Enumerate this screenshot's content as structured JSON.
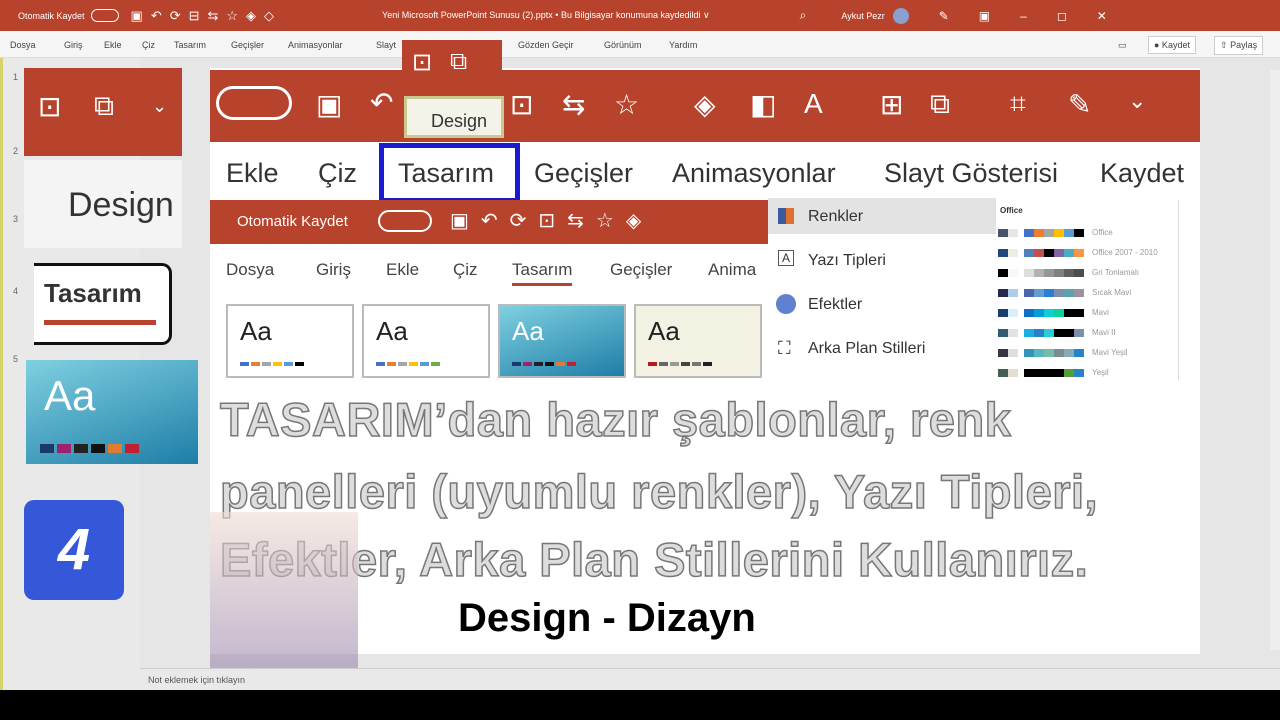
{
  "titlebar": {
    "autosave": "Otomatik Kaydet",
    "title": "Yeni Microsoft PowerPoint Sunusu (2).pptx • Bu Bilgisayar konumuna kaydedildi ∨",
    "user": "Aykut Pezr"
  },
  "ribbon_tabs": [
    "Dosya",
    "Giriş",
    "Ekle",
    "Çiz",
    "Tasarım",
    "Geçişler",
    "Animasyonlar",
    "Slayt",
    "Gözden Geçir",
    "Görünüm",
    "Yardım"
  ],
  "ribbon_right": {
    "save": "● Kaydet",
    "share": "Paylaş"
  },
  "thumb_numbers": [
    "1",
    "2",
    "3",
    "4",
    "5"
  ],
  "thumbs": {
    "design": "Design",
    "tasarim": "Tasarım",
    "aa": "Aa",
    "badge": "4"
  },
  "zoomed": {
    "tooltip": "Design",
    "tabs": [
      "Ekle",
      "Çiz",
      "Tasarım",
      "Geçişler",
      "Animasyonlar",
      "Slayt Gösterisi",
      "Kaydet"
    ],
    "inner_autosave": "Otomatik Kaydet",
    "inner_tabs": [
      "Dosya",
      "Giriş",
      "Ekle",
      "Çiz",
      "Tasarım",
      "Geçişler",
      "Anima"
    ],
    "gallery_aa": "Aa"
  },
  "menu": {
    "items": [
      "Renkler",
      "Yazı Tipleri",
      "Efektler",
      "Arka Plan Stilleri"
    ]
  },
  "palettes": {
    "header": "Office",
    "items": [
      {
        "name": "Office",
        "colors": [
          "#44546a",
          "#e7e6e6",
          "#4472c4",
          "#ed7d31",
          "#a5a5a5",
          "#ffc000",
          "#5b9bd5",
          "#000"
        ]
      },
      {
        "name": "Office 2007 - 2010",
        "colors": [
          "#1f497d",
          "#eeece1",
          "#4f81bd",
          "#c0504d",
          "#000",
          "#8064a2",
          "#4bacc6",
          "#f79646"
        ]
      },
      {
        "name": "Gri Tonlamalı",
        "colors": [
          "#000",
          "#f8f8f8",
          "#ddd",
          "#b2b2b2",
          "#969696",
          "#808080",
          "#5f5f5f",
          "#4d4d4d"
        ]
      },
      {
        "name": "Sıcak Mavi",
        "colors": [
          "#242852",
          "#acccea",
          "#4a66ac",
          "#629dd1",
          "#297fd5",
          "#7f8fa9",
          "#5aa2ae",
          "#9d90a0"
        ]
      },
      {
        "name": "Mavi",
        "colors": [
          "#17406d",
          "#dbeff9",
          "#0f6fc6",
          "#009dd9",
          "#0bd0d9",
          "#10cf9b",
          "#000",
          "#000"
        ]
      },
      {
        "name": "Mavi II",
        "colors": [
          "#335b74",
          "#dfe3e5",
          "#1cade4",
          "#2683c6",
          "#27ced7",
          "#000",
          "#000",
          "#7f8fa9"
        ]
      },
      {
        "name": "Mavi Yeşil",
        "colors": [
          "#373545",
          "#dedede",
          "#3494ba",
          "#58b6c0",
          "#75bda7",
          "#7a8c8e",
          "#84acb6",
          "#2683c6"
        ]
      },
      {
        "name": "Yeşil",
        "colors": [
          "#455f51",
          "#e3ded1",
          "#000",
          "#000",
          "#000",
          "#000",
          "#549e39",
          "#2683c6"
        ]
      }
    ]
  },
  "slide": {
    "line1": "TASARIM’dan hazır şablonlar, renk",
    "line2": "panelleri (uyumlu renkler), Yazı Tipleri,",
    "line3": "Efektler, Arka Plan Stillerini Kullanırız.",
    "subtitle": "Design - Dizayn"
  },
  "notes": "Not eklemek için tıklayın",
  "colors": {
    "accent": "#b8432d",
    "highlight": "#1a1ad0"
  }
}
